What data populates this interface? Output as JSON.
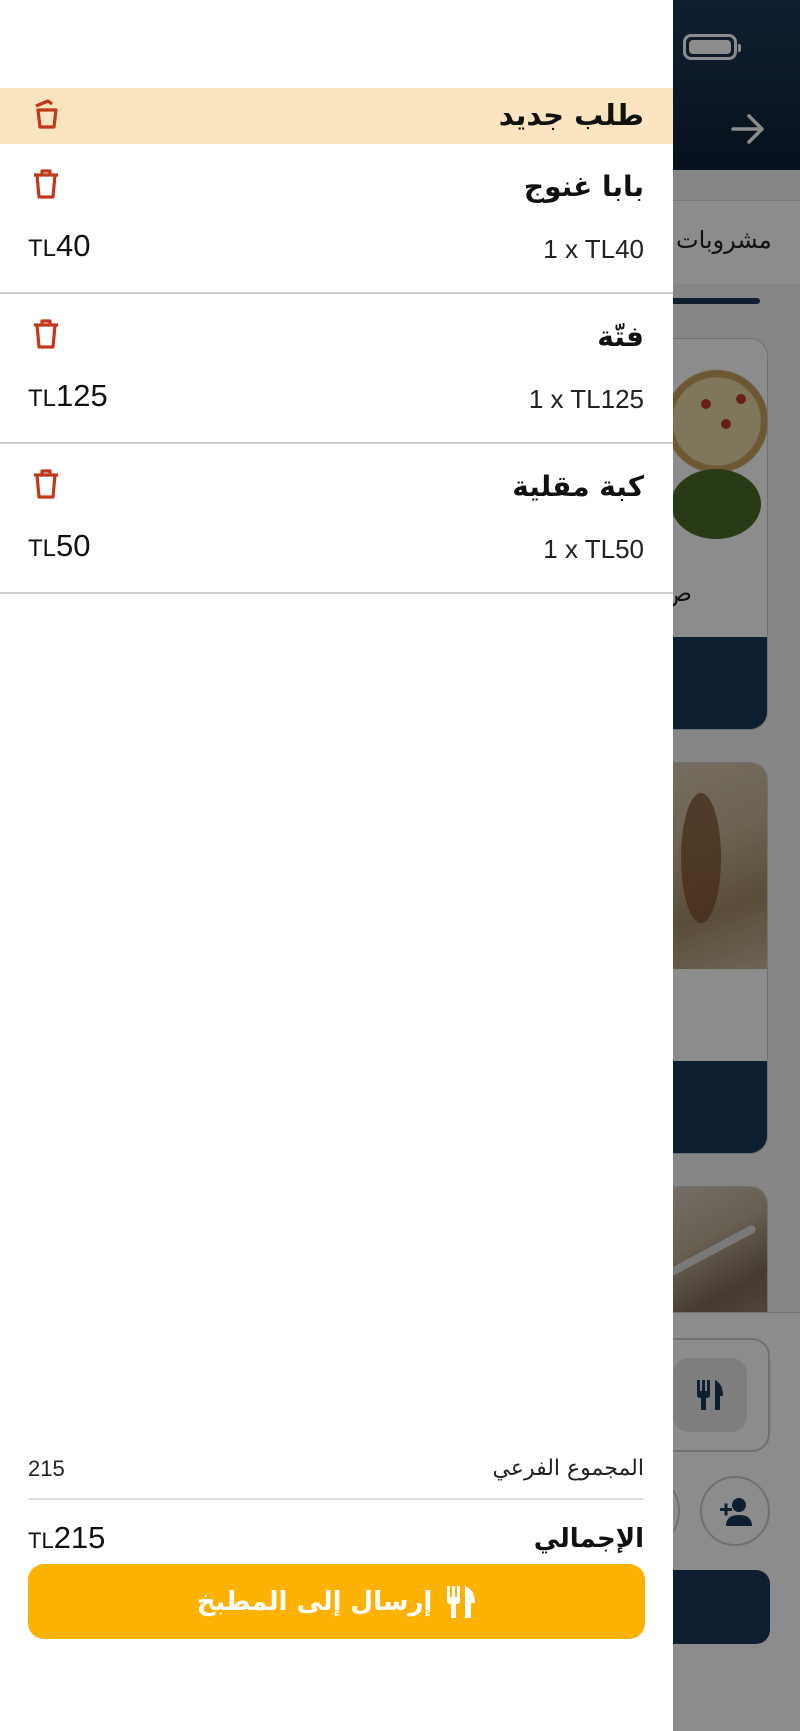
{
  "background": {
    "tab_label": "مشروبات",
    "card_text": "ص"
  },
  "drawer": {
    "title": "طلب جديد",
    "items": [
      {
        "name": "بابا غنوج",
        "quantity_line": "1 x TL40",
        "currency": "TL",
        "amount": "40"
      },
      {
        "name": "فتّة",
        "quantity_line": "1 x TL125",
        "currency": "TL",
        "amount": "125"
      },
      {
        "name": "كبة مقلية",
        "quantity_line": "1 x TL50",
        "currency": "TL",
        "amount": "50"
      }
    ],
    "subtotal_label": "المجموع الفرعي",
    "subtotal_value": "215",
    "total_label": "الإجمالي",
    "total_currency": "TL",
    "total_amount": "215",
    "send_button_label": "إرسال إلى المطبخ"
  },
  "icons": {
    "header_icon": "clear-order-icon",
    "item_icon": "trash-icon",
    "send_icon": "utensils-icon"
  },
  "colors": {
    "accent": "#fbb203",
    "trash": "#c0391b",
    "title_bar": "#fbe5c0",
    "navy": "#1c3a5c"
  }
}
